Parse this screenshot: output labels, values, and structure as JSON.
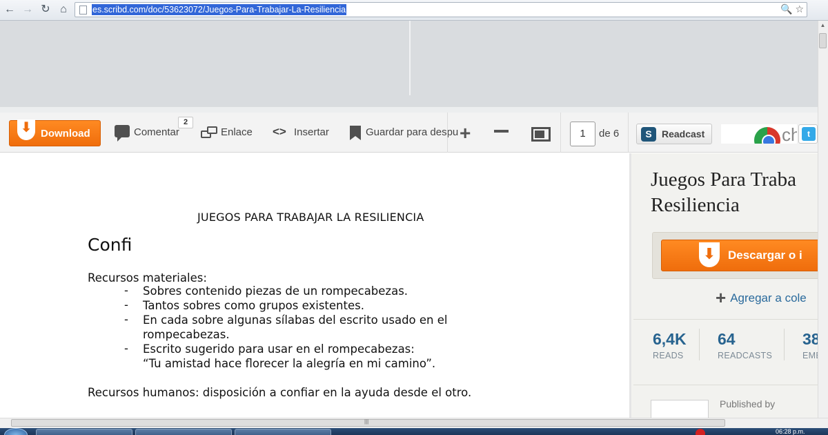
{
  "browser": {
    "back_icon": "back-arrow-icon",
    "forward_icon": "forward-arrow-icon",
    "reload_icon": "reload-icon",
    "home_icon": "home-icon",
    "url": "es.scribd.com/doc/53623072/Juegos-Para-Trabajar-La-Resiliencia"
  },
  "toolbar": {
    "download_label": "Download",
    "comment_label": "Comentar",
    "comment_count": "2",
    "link_label": "Enlace",
    "embed_label": "Insertar",
    "save_label": "Guardar para despu",
    "page_current": "1",
    "page_of": "de 6",
    "readcast_label": "Readcast",
    "ad_text": "ch"
  },
  "document": {
    "title": "JUEGOS PARA TRABAJAR LA RESILIENCIA",
    "heading": "Confi",
    "material_heading": "Recursos materiales:",
    "items": [
      "Sobres contenido piezas de un rompecabezas.",
      "Tantos sobres como grupos existentes.",
      "En cada sobre algunas sílabas del escrito usado en el",
      "rompecabezas.",
      "Escrito sugerido para usar en el rompecabezas:",
      "“Tu amistad hace florecer la alegría en mi camino”."
    ],
    "dash": "-",
    "human_resources": "Recursos humanos: disposición a confiar en la ayuda desde el otro."
  },
  "sidebar": {
    "title_line1": "Juegos Para Traba",
    "title_line2": "Resiliencia",
    "download_button": "Descargar o i",
    "add_collection": "Agregar a cole",
    "stats": [
      {
        "value": "6,4K",
        "label": "READS"
      },
      {
        "value": "64",
        "label": "READCASTS"
      },
      {
        "value": "38",
        "label": "EMB"
      }
    ],
    "published_by": "Published by"
  },
  "taskbar": {
    "time": "06:28 p.m."
  },
  "colors": {
    "accent_orange": "#ef6d0c",
    "link_blue": "#2a6a9c",
    "stat_blue": "#27638f"
  }
}
